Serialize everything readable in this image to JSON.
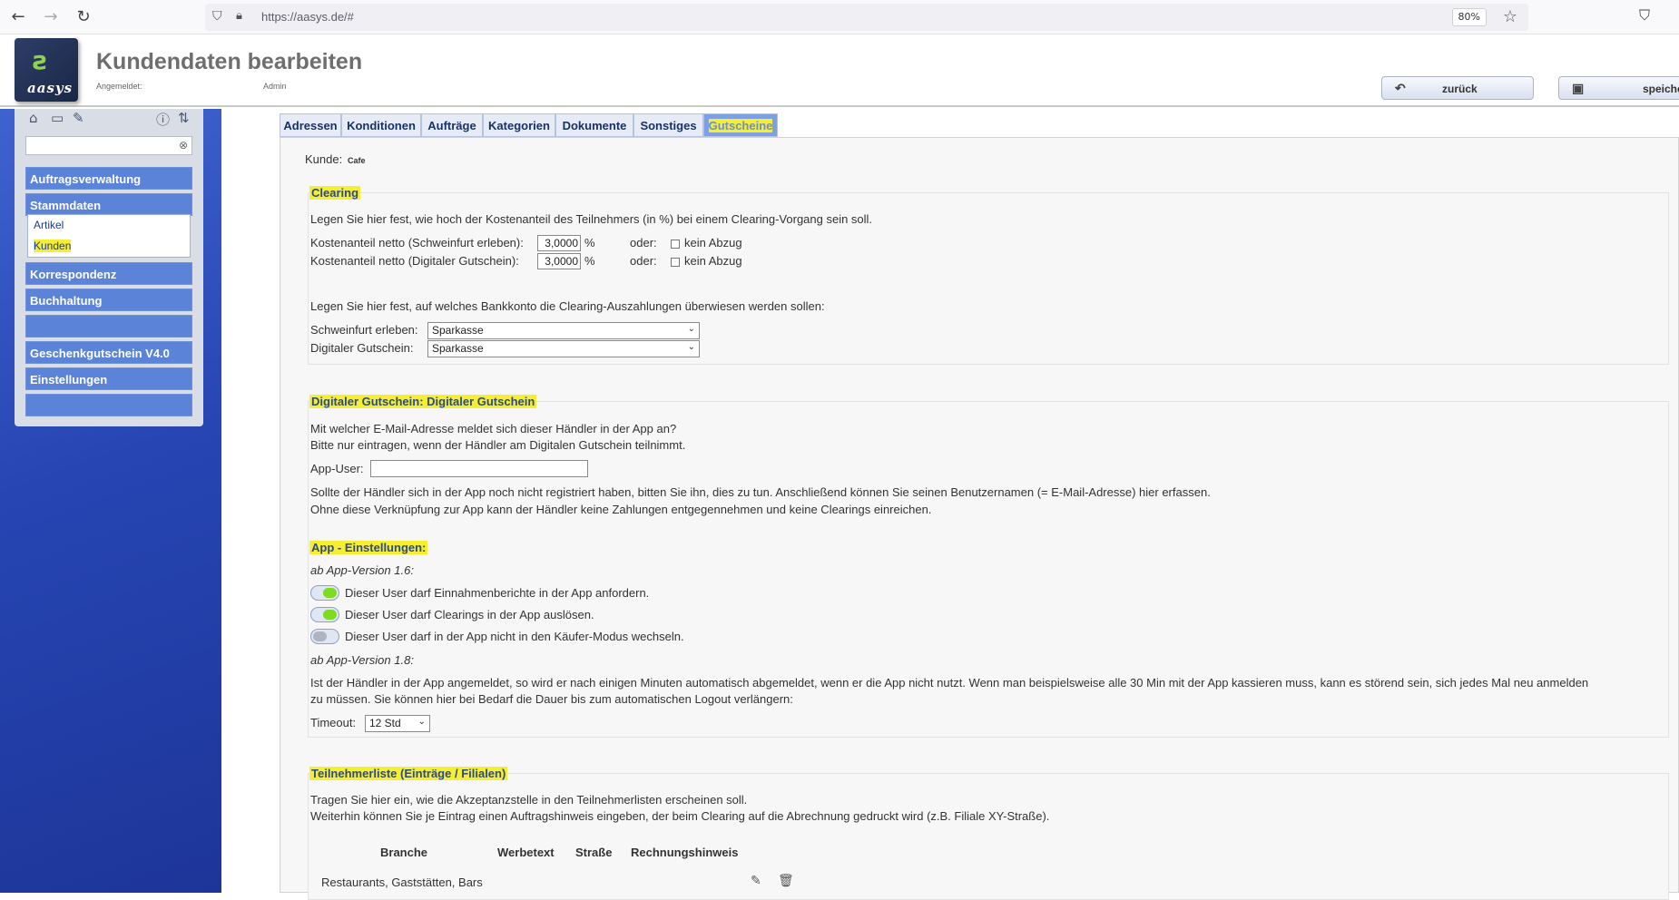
{
  "browser": {
    "url": "https://aasys.de/#",
    "zoom": "80%"
  },
  "header": {
    "logo_text": "aasys",
    "title": "Kundendaten bearbeiten",
    "login_label": "Angemeldet:",
    "login_user": "Admin",
    "back_label": "zurück",
    "save_label": "speichern"
  },
  "sidebar": {
    "search_value": "",
    "items": [
      {
        "label": "Auftragsverwaltung"
      },
      {
        "label": "Stammdaten"
      },
      {
        "label": "Korrespondenz"
      },
      {
        "label": "Buchhaltung"
      },
      {
        "label": ""
      },
      {
        "label": "Geschenkgutschein V4.0"
      },
      {
        "label": "Einstellungen"
      },
      {
        "label": ""
      }
    ],
    "sub_items": [
      {
        "label": "Artikel"
      },
      {
        "label": "Kunden"
      }
    ]
  },
  "tabs": [
    {
      "label": "Adressen"
    },
    {
      "label": "Konditionen"
    },
    {
      "label": "Aufträge"
    },
    {
      "label": "Kategorien"
    },
    {
      "label": "Dokumente"
    },
    {
      "label": "Sonstiges"
    },
    {
      "label": "Gutscheine"
    }
  ],
  "customer": {
    "label": "Kunde:",
    "name": "Cafe"
  },
  "clearing": {
    "title": "Clearing",
    "intro": "Legen Sie hier fest, wie hoch der Kostenanteil des Teilnehmers (in %) bei einem Clearing-Vorgang sein soll.",
    "row1_label": "Kostenanteil netto (Schweinfurt erleben):",
    "row1_value": "3,0000",
    "row2_label": "Kostenanteil netto (Digitaler Gutschein):",
    "row2_value": "3,0000",
    "percent": "%",
    "oder": "oder:",
    "kein_abzug": "kein Abzug",
    "bank_intro": "Legen Sie hier fest, auf welches Bankkonto die Clearing-Auszahlungen überwiesen werden sollen:",
    "bank1_label": "Schweinfurt erleben:",
    "bank1_value": "Sparkasse",
    "bank2_label": "Digitaler Gutschein:",
    "bank2_value": "Sparkasse"
  },
  "digital": {
    "title": "Digitaler Gutschein: Digitaler Gutschein",
    "line1": "Mit welcher E-Mail-Adresse meldet sich dieser Händler in der App an?",
    "line2": "Bitte nur eintragen, wenn der Händler am Digitalen Gutschein teilnimmt.",
    "app_user_label": "App-User:",
    "app_user_value": "",
    "info1": "Sollte der Händler sich in der App noch nicht registriert haben, bitten Sie ihn, dies zu tun. Anschließend können Sie seinen Benutzernamen (= E-Mail-Adresse) hier erfassen.",
    "info2": "Ohne diese Verknüpfung zur App kann der Händler keine Zahlungen entgegennehmen und keine Clearings einreichen."
  },
  "app_settings": {
    "title": "App - Einstellungen:",
    "version1": "ab App-Version 1.6:",
    "toggles": [
      {
        "label": "Dieser User darf Einnahmenberichte in der App anfordern.",
        "on": true
      },
      {
        "label": "Dieser User darf Clearings in der App auslösen.",
        "on": true
      },
      {
        "label": "Dieser User darf in der App nicht in den Käufer-Modus wechseln.",
        "on": false
      }
    ],
    "version2": "ab App-Version 1.8:",
    "timeout_text1": "Ist der Händler in der App angemeldet, so wird er nach einigen Minuten automatisch abgemeldet, wenn er die App nicht nutzt. Wenn man beispielsweise alle 30 Min mit der App kassieren muss, kann es störend sein, sich jedes Mal neu anmelden",
    "timeout_text2": "zu müssen. Sie können hier bei Bedarf die Dauer bis zum automatischen Logout verlängern:",
    "timeout_label": "Timeout:",
    "timeout_value": "12 Std"
  },
  "participants": {
    "title": "Teilnehmerliste (Einträge / Filialen)",
    "line1": "Tragen Sie hier ein, wie die Akzeptanzstelle in den Teilnehmerlisten erscheinen soll.",
    "line2": "Weiterhin können Sie je Eintrag einen Auftragshinweis eingeben, der beim Clearing auf die Abrechnung gedruckt wird (z.B. Filiale XY-Straße).",
    "columns": [
      "Branche",
      "Werbetext",
      "Straße",
      "Rechnungshinweis"
    ],
    "rows": [
      {
        "branche": "Restaurants, Gaststätten, Bars"
      }
    ]
  }
}
